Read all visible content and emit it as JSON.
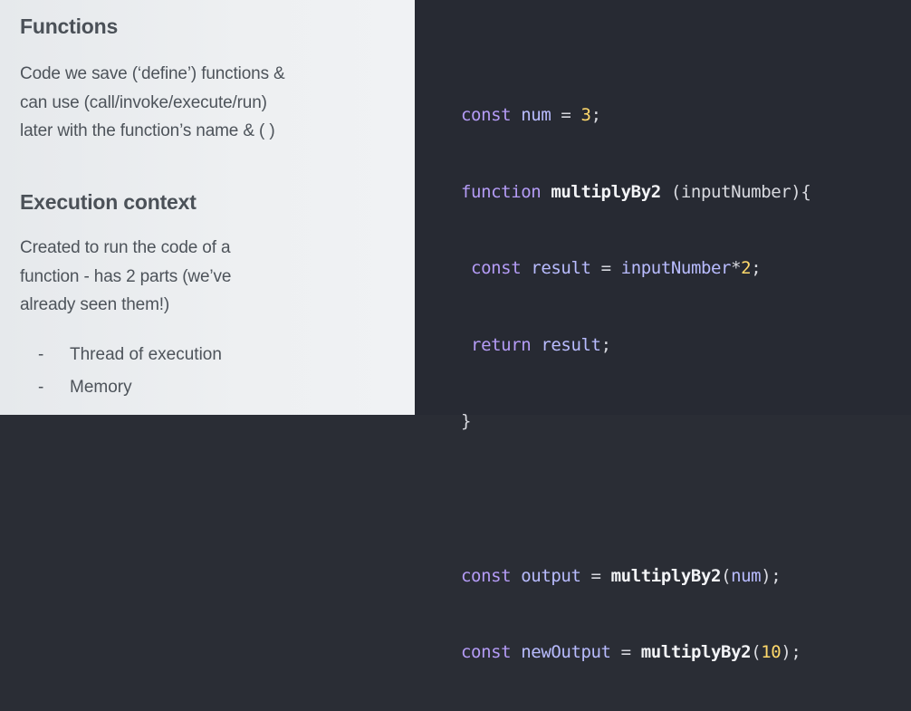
{
  "left": {
    "functions_heading": "Functions",
    "functions_text": "Code we save (‘define’) functions &\ncan use (call/invoke/execute/run)\nlater with the function’s name & ( )",
    "context_heading": "Execution context",
    "context_text": "Created to run the code of a\nfunction - has 2 parts (we’ve\nalready seen them!)",
    "parts": [
      {
        "bullet": "-",
        "label": "Thread of execution"
      },
      {
        "bullet": "-",
        "label": "Memory"
      }
    ]
  },
  "code": {
    "l1": {
      "kw": "const",
      "name": "num",
      "eq": "=",
      "val": "3",
      "end": ";"
    },
    "l2": {
      "kw": "function",
      "name": "multiplyBy2",
      "params": "(inputNumber){"
    },
    "l3": {
      "kw": "const",
      "name": "result",
      "eq": "=",
      "expr": "inputNumber",
      "op": "*",
      "val": "2",
      "end": ";"
    },
    "l4": {
      "kw": "return",
      "name": "result",
      "end": ";"
    },
    "l5": {
      "brace": "}"
    },
    "l6": {
      "kw": "const",
      "name": "output",
      "eq": "=",
      "call": "multiplyBy2",
      "open": "(",
      "arg": "num",
      "close": ");"
    },
    "l7": {
      "kw": "const",
      "name": "newOutput",
      "eq": "=",
      "call": "multiplyBy2",
      "open": "(",
      "arg": "10",
      "close": ");"
    }
  },
  "colors": {
    "left_bg": "#eef0f2",
    "code_bg": "#272a33",
    "keyword": "#b59cf7",
    "number": "#ffd96b"
  }
}
